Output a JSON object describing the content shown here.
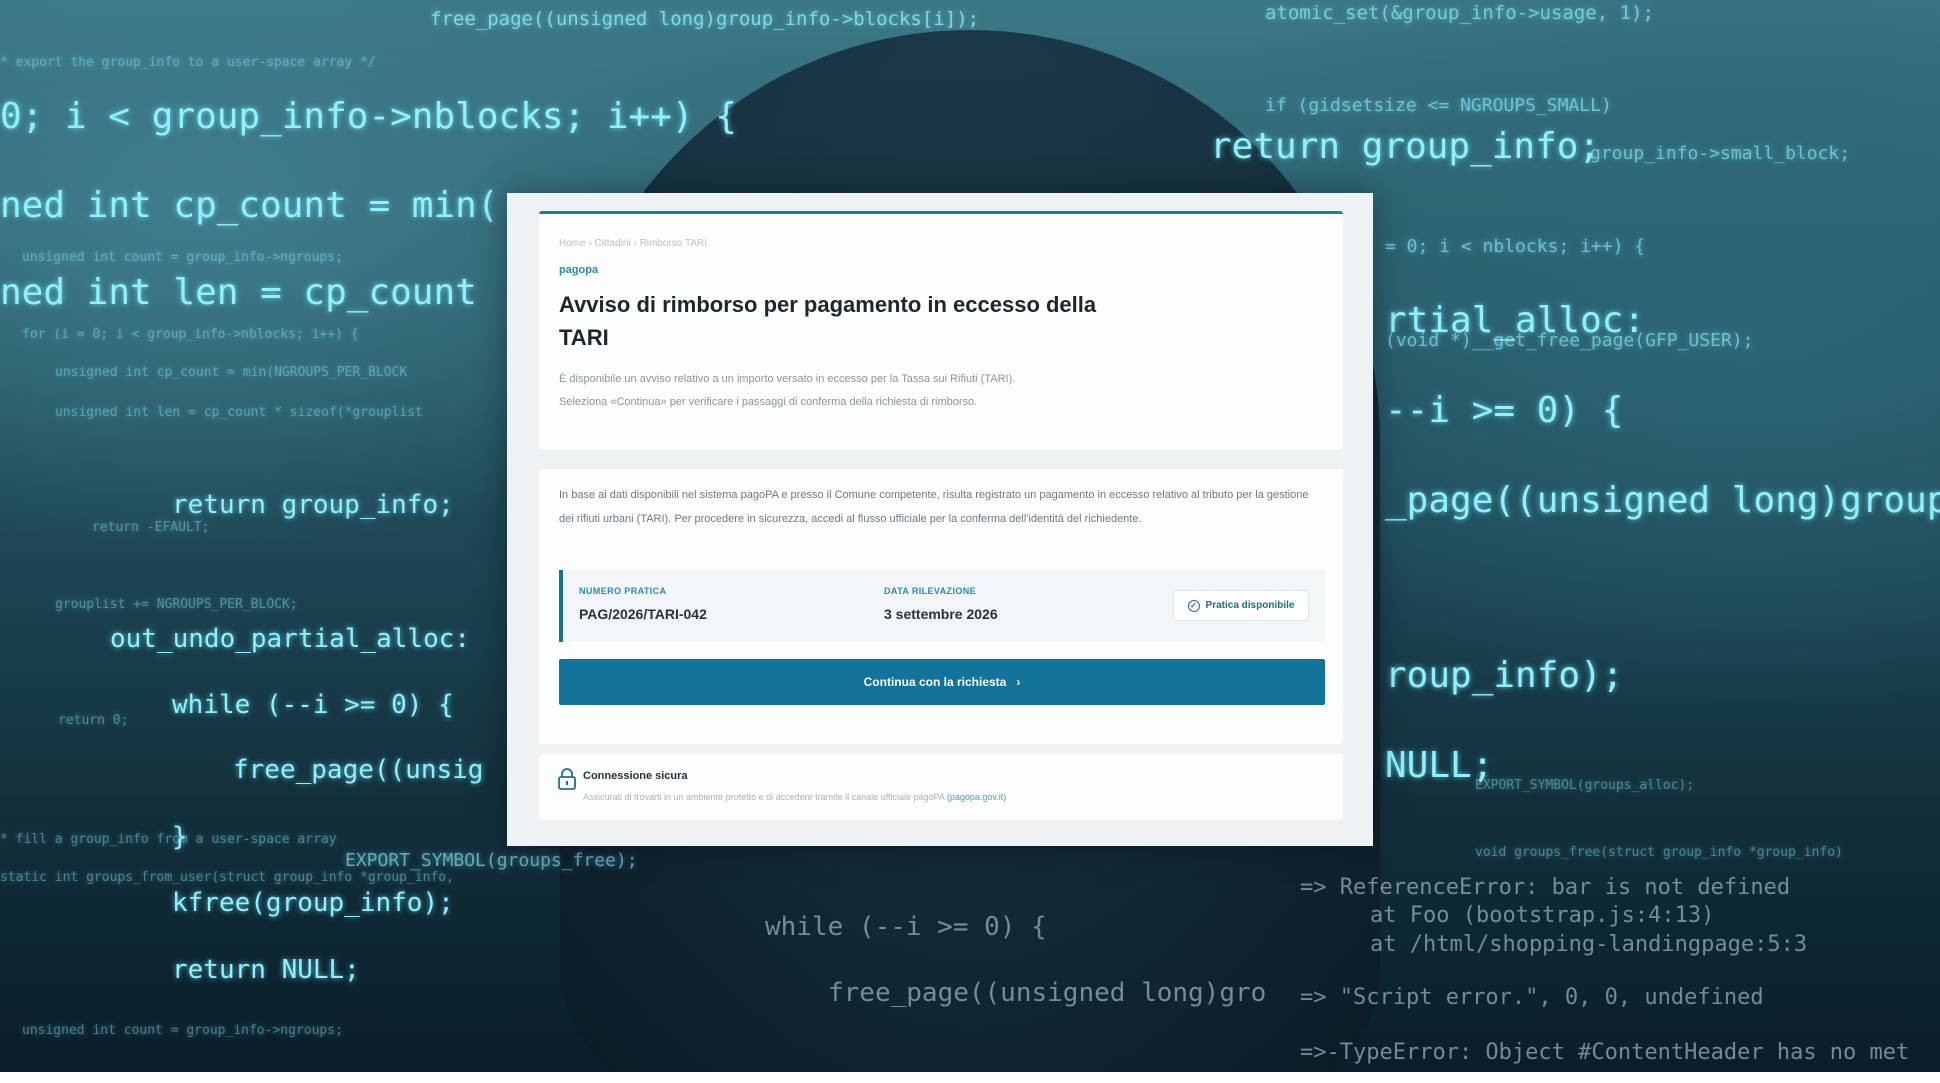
{
  "background_code": {
    "lines": [
      "free_page((unsigned long)group_info->blocks[i]);",
      "atomic_set(&group_info->usage, 1);",
      "* export the group_info to a user-space array */",
      "0; i < group_info->nblocks; i++) {",
      "return group_info;",
      "ned int cp_count = min(",
      "unsigned int count = group_info->ngroups;",
      "ned int len = cp_count",
      "rtial_alloc:",
      "for (i = 0; i < group_info->nblocks; i++) {",
      "--i >= 0) {",
      "unsigned int cp_count = min(NGROUPS_PER_BLOCK",
      "unsigned int len = cp_count * sizeof(*grouplist",
      "return group_info;",
      "_page((unsigned long)group",
      "return -EFAULT;",
      "grouplist += NGROUPS_PER_BLOCK;",
      "out_undo_partial_alloc:",
      "roup_info);",
      "while (--i >= 0) {",
      "return 0;",
      "NULL;",
      "free_page((unsig",
      "EXPORT_SYMBOL(groups_alloc);",
      "}",
      "* fill a group_info from a user-space array",
      "EXPORT_SYMBOL(groups_free);",
      "void groups_free(struct group_info *group_info)",
      "static int groups_from_user(struct group_info *group_info,",
      "=> ReferenceError: bar is not defined",
      "kfree(group_info);",
      "at Foo (bootstrap.js:4:13)",
      "while (--i >= 0) {",
      "at /html/shopping-landingpage:5:3",
      "return NULL;",
      "free_page((unsigned long)gro",
      "=> \"Script error.\", 0, 0, undefined",
      "unsigned int count = group_info->ngroups;",
      "=>-TypeError: Object #ContentHeader has no met",
      "if (gidsetsize <= NGROUPS_SMALL)",
      "group_info->small_block;",
      "= 0; i < nblocks; i++) {",
      "(void *)__get_free_page(GFP_USER);"
    ]
  },
  "dialog": {
    "breadcrumb": "Home  ›  Cittadini  ›  Rimborso TARI",
    "brand": "pagopa",
    "title": "Avviso di rimborso per pagamento in eccesso della TARI",
    "intro": "È disponibile un avviso relativo a un importo versato in eccesso per la Tassa sui Rifiuti (TARI). Seleziona «Continua» per verificare i passaggi di conferma della richiesta di rimborso.",
    "body_text": "In base ai dati disponibili nel sistema pagoPA e presso il Comune competente, risulta registrato un pagamento in eccesso relativo al tributo per la gestione dei rifiuti urbani (TARI). Per procedere in sicurezza, accedi al flusso ufficiale per la conferma dell'identità del richiedente.",
    "practice_number_label": "NUMERO PRATICA",
    "practice_number": "PAG/2026/TARI-042",
    "detection_date_label": "DATA RILEVAZIONE",
    "detection_date": "3 settembre 2026",
    "status_badge": "Pratica disponibile",
    "cta_label": "Continua con la richiesta",
    "cta_arrow": "›",
    "secure_title": "Connessione sicura",
    "secure_text": "Assicurati di trovarti in un ambiente protetto e di accedere tramite il canale ufficiale pagoPA",
    "secure_link": "(pagopa.gov.it)"
  },
  "colors": {
    "accent": "#13739a",
    "brand_text": "#2a8bb0",
    "code_glow": "#8ff0ff"
  },
  "icons": {
    "status": "check-circle-icon",
    "cta": "chevron-right-icon",
    "secure": "lock-icon"
  }
}
